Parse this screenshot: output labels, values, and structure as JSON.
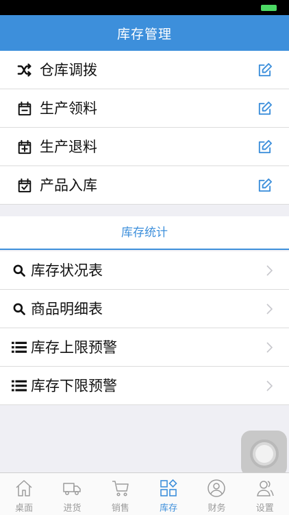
{
  "nav": {
    "title": "库存管理"
  },
  "management": {
    "items": [
      {
        "label": "仓库调拨",
        "icon": "shuffle-icon"
      },
      {
        "label": "生产领料",
        "icon": "calendar-minus-icon"
      },
      {
        "label": "生产退料",
        "icon": "calendar-plus-icon"
      },
      {
        "label": "产品入库",
        "icon": "calendar-check-icon"
      }
    ],
    "action_icon": "edit-icon"
  },
  "stats": {
    "title": "库存统计",
    "items": [
      {
        "label": "库存状况表",
        "icon": "search-icon"
      },
      {
        "label": "商品明细表",
        "icon": "search-icon"
      },
      {
        "label": "库存上限预警",
        "icon": "list-icon"
      },
      {
        "label": "库存下限预警",
        "icon": "list-icon"
      }
    ]
  },
  "tabs": [
    {
      "label": "桌面",
      "icon": "home-icon"
    },
    {
      "label": "进货",
      "icon": "truck-icon"
    },
    {
      "label": "销售",
      "icon": "cart-icon"
    },
    {
      "label": "库存",
      "icon": "grid-icon",
      "active": true
    },
    {
      "label": "财务",
      "icon": "user-circle-icon"
    },
    {
      "label": "设置",
      "icon": "users-icon"
    }
  ],
  "colors": {
    "accent": "#3d8fdb",
    "battery": "#4cd964",
    "inactive": "#9b9b9b"
  }
}
